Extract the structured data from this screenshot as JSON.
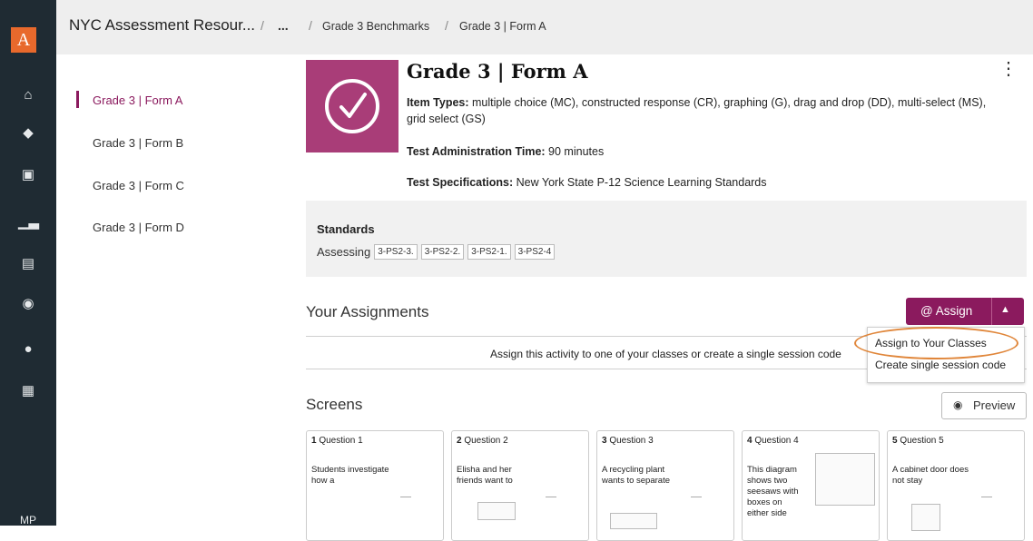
{
  "rail": {
    "logo_letter": "A",
    "icons": [
      "home-icon",
      "graduation-cap-icon",
      "bookmark-icon",
      "bar-chart-icon",
      "document-icon",
      "presenter-icon",
      "user-settings-icon",
      "grid-icon"
    ],
    "user_initials": "MP"
  },
  "breadcrumb": {
    "root": "NYC Assessment Resour...",
    "ellipsis": "...",
    "level2": "Grade 3 Benchmarks",
    "current": "Grade 3 | Form A"
  },
  "side_nav": [
    {
      "label": "Grade 3 | Form A",
      "active": true
    },
    {
      "label": "Grade 3 | Form B",
      "active": false
    },
    {
      "label": "Grade 3 | Form C",
      "active": false
    },
    {
      "label": "Grade 3 | Form D",
      "active": false
    }
  ],
  "header": {
    "title": "Grade 3 | Form A",
    "item_types_label": "Item Types:",
    "item_types_value": " multiple choice (MC), constructed response (CR), graphing (G), drag and drop (DD), multi-select (MS), grid select (GS)",
    "admin_time_label": "Test Administration Time:",
    "admin_time_value": " 90 minutes",
    "specs_label": "Test Specifications:",
    "specs_value": " New York State P-12 Science Learning Standards"
  },
  "standards": {
    "title": "Standards",
    "assessing_label": "Assessing",
    "chips": [
      "3-PS2-3.",
      "3-PS2-2.",
      "3-PS2-1.",
      "3-PS2-4"
    ]
  },
  "assignments": {
    "title": "Your Assignments",
    "assign_label": "@ Assign",
    "empty_text": "Assign this activity to one of your classes or create a single session code",
    "menu": [
      "Assign to Your Classes",
      "Create single session code"
    ]
  },
  "screens": {
    "title": "Screens",
    "preview_label": "Preview",
    "cards": [
      {
        "num": "1",
        "title": "Question 1",
        "text": "Students investigate how a"
      },
      {
        "num": "2",
        "title": "Question 2",
        "text": "Elisha and her friends want to"
      },
      {
        "num": "3",
        "title": "Question 3",
        "text": "A recycling plant wants to separate"
      },
      {
        "num": "4",
        "title": "Question 4",
        "text": "This diagram shows two seesaws with boxes on either side"
      },
      {
        "num": "5",
        "title": "Question 5",
        "text": "A cabinet door does not stay"
      }
    ]
  },
  "colors": {
    "accent": "#8b1a5e",
    "thumb": "#a93d78",
    "rail": "#1f2b33",
    "logo": "#e8692c",
    "highlight": "#e0863a"
  }
}
